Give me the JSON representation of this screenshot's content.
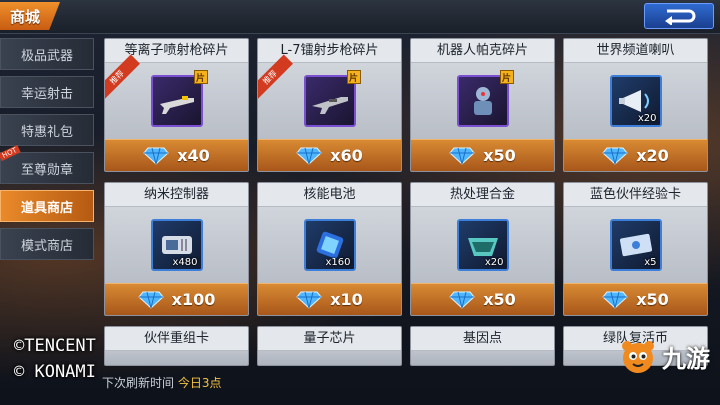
{
  "header": {
    "title": "商城"
  },
  "sidebar": {
    "items": [
      {
        "label": "极品武器",
        "active": false,
        "badge": ""
      },
      {
        "label": "幸运射击",
        "active": false,
        "badge": ""
      },
      {
        "label": "特惠礼包",
        "active": false,
        "badge": ""
      },
      {
        "label": "至尊勋章",
        "active": false,
        "badge": "HOT"
      },
      {
        "label": "道具商店",
        "active": true,
        "badge": ""
      },
      {
        "label": "模式商店",
        "active": false,
        "badge": ""
      }
    ]
  },
  "shop": {
    "items": [
      {
        "name": "等离子喷射枪碎片",
        "price": "x40",
        "qty": "",
        "ribbon": "推荐",
        "fragment": true,
        "icon": "plasma-rifle-icon"
      },
      {
        "name": "L-7镭射步枪碎片",
        "price": "x60",
        "qty": "",
        "ribbon": "推荐",
        "fragment": true,
        "icon": "laser-rifle-icon"
      },
      {
        "name": "机器人帕克碎片",
        "price": "x50",
        "qty": "",
        "ribbon": "",
        "fragment": true,
        "icon": "robot-icon"
      },
      {
        "name": "世界频道喇叭",
        "price": "x20",
        "qty": "x20",
        "ribbon": "",
        "fragment": false,
        "icon": "megaphone-icon"
      },
      {
        "name": "纳米控制器",
        "price": "x100",
        "qty": "x480",
        "ribbon": "",
        "fragment": false,
        "icon": "nano-controller-icon"
      },
      {
        "name": "核能电池",
        "price": "x10",
        "qty": "x160",
        "ribbon": "",
        "fragment": false,
        "icon": "battery-icon"
      },
      {
        "name": "热处理合金",
        "price": "x50",
        "qty": "x20",
        "ribbon": "",
        "fragment": false,
        "icon": "alloy-icon"
      },
      {
        "name": "蓝色伙伴经验卡",
        "price": "x50",
        "qty": "x5",
        "ribbon": "",
        "fragment": false,
        "icon": "exp-card-icon"
      },
      {
        "name": "伙伴重组卡",
        "price": "",
        "qty": "",
        "ribbon": "",
        "fragment": false,
        "icon": ""
      },
      {
        "name": "量子芯片",
        "price": "",
        "qty": "",
        "ribbon": "",
        "fragment": false,
        "icon": ""
      },
      {
        "name": "基因点",
        "price": "",
        "qty": "",
        "ribbon": "",
        "fragment": false,
        "icon": ""
      },
      {
        "name": "绿队复活币",
        "price": "",
        "qty": "",
        "ribbon": "",
        "fragment": false,
        "icon": ""
      }
    ],
    "fragment_mark": "片"
  },
  "footer": {
    "refresh_label": "下次刷新时间",
    "refresh_value": "今日3点"
  },
  "watermarks": {
    "line1": "©TENCENT",
    "line2": "© KONAMI",
    "brand": "九游"
  },
  "colors": {
    "accent": "#e98a2a",
    "price_bar": "#c06b22",
    "gem": "#4fb6ff"
  }
}
